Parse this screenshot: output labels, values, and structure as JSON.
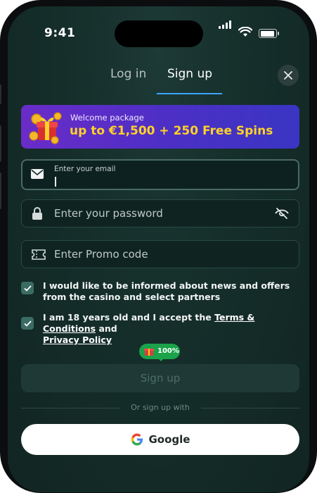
{
  "status_bar": {
    "time": "9:41"
  },
  "tabs": [
    {
      "label": "Log in",
      "active": false
    },
    {
      "label": "Sign up",
      "active": true
    }
  ],
  "banner": {
    "label": "Welcome package",
    "amount": "up to €1,500 + 250 Free Spins"
  },
  "form": {
    "email": {
      "label": "Enter your email",
      "value": ""
    },
    "password": {
      "placeholder": "Enter your password"
    },
    "promo": {
      "placeholder": "Enter Promo code"
    }
  },
  "consents": [
    {
      "text": "I would like to be informed about news and offers from the casino and select partners",
      "checked": true
    },
    {
      "prefix": "I am 18 years old and I accept the ",
      "link1": "Terms & Conditions",
      "middle": " and ",
      "link2": "Privacy Policy",
      "checked": true
    }
  ],
  "bonus_badge": {
    "label": "100%"
  },
  "signup_button": {
    "label": "Sign up",
    "enabled": false
  },
  "divider_text": "Or sign up with",
  "google_button": {
    "label": "Google"
  },
  "colors": {
    "accent": "#3aa6ff",
    "banner_gold": "#ffd227",
    "badge_green": "#1aa34a",
    "background": "#16302c"
  }
}
